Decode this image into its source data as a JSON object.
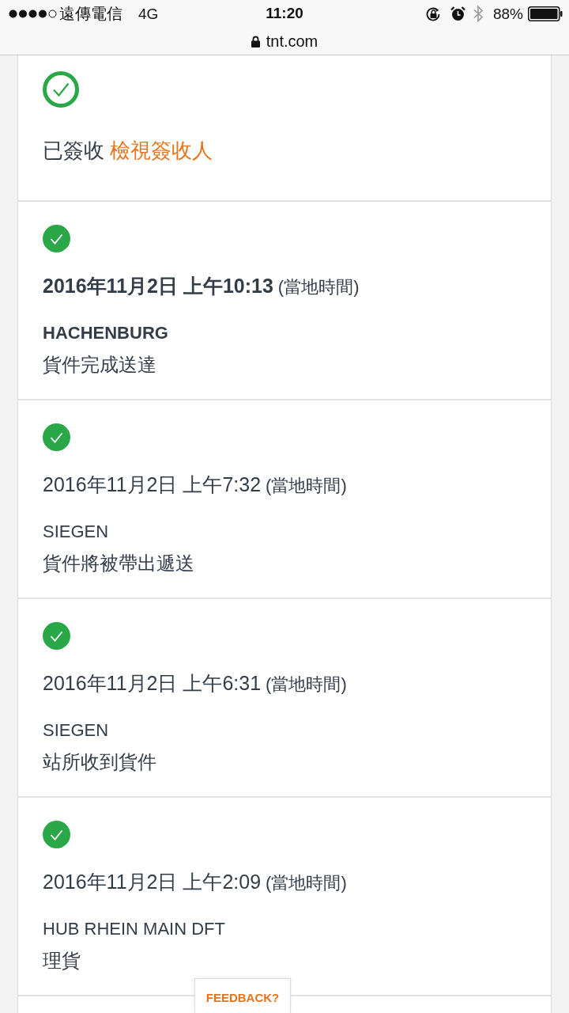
{
  "status_bar": {
    "carrier": "遠傳電信",
    "network": "4G",
    "time": "11:20",
    "battery": "88%"
  },
  "address_bar": {
    "url": "tnt.com",
    "secure": true
  },
  "delivery_summary": {
    "status": "已簽收",
    "link": "檢視簽收人"
  },
  "events": [
    {
      "datetime": "2016年11月2日 上午10:13",
      "note": "(當地時間)",
      "location": "HACHENBURG",
      "description": "貨件完成送達",
      "latest": true
    },
    {
      "datetime": "2016年11月2日 上午7:32",
      "note": "(當地時間)",
      "location": "SIEGEN",
      "description": "貨件將被帶出遞送",
      "latest": false
    },
    {
      "datetime": "2016年11月2日 上午6:31",
      "note": "(當地時間)",
      "location": "SIEGEN",
      "description": "站所收到貨件",
      "latest": false
    },
    {
      "datetime": "2016年11月2日 上午2:09",
      "note": "(當地時間)",
      "location": "HUB RHEIN MAIN DFT",
      "description": "理貨",
      "latest": false
    }
  ],
  "feedback_button": {
    "label": "FEEDBACK?"
  }
}
